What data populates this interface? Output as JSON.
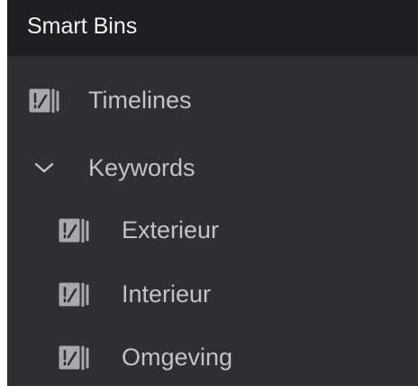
{
  "panel": {
    "title": "Smart Bins"
  },
  "items": [
    {
      "label": "Timelines",
      "icon": "smart-bin-icon",
      "level": 0
    },
    {
      "label": "Keywords",
      "icon": "chevron-down-icon",
      "level": 0,
      "expanded": true
    },
    {
      "label": "Exterieur",
      "icon": "smart-bin-icon",
      "level": 1
    },
    {
      "label": "Interieur",
      "icon": "smart-bin-icon",
      "level": 1
    },
    {
      "label": "Omgeving",
      "icon": "smart-bin-icon",
      "level": 1
    }
  ],
  "colors": {
    "panel_background": "#2f2f32",
    "header_background": "#1f1f21",
    "title_text": "#f2f2f2",
    "item_text": "#c3c3c5",
    "icon": "#a9a9ab"
  }
}
